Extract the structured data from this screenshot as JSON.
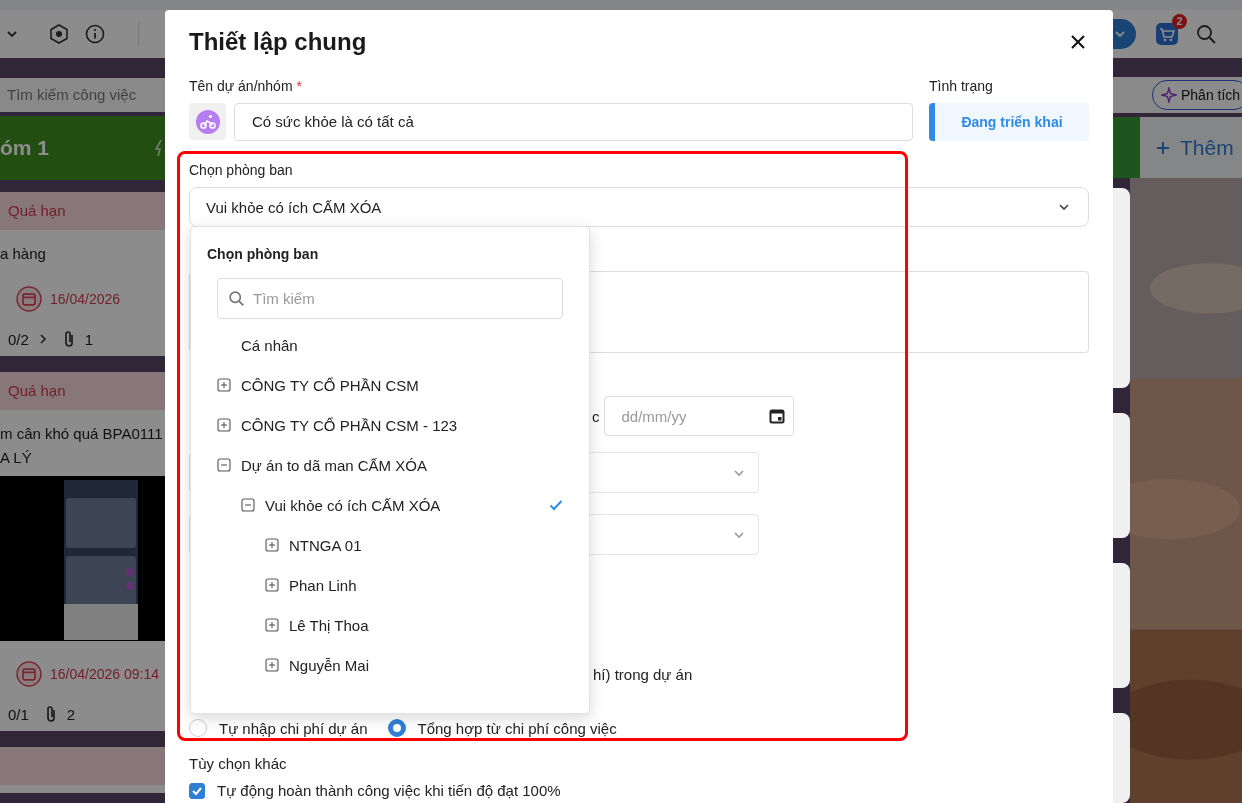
{
  "board": {
    "search": {
      "placeholder": "Tìm kiếm công việc"
    },
    "column_title": "óm 1",
    "cards": [
      {
        "overdue": true,
        "status": "Quá hạn",
        "lines": [
          "a hàng"
        ],
        "date": "16/04/2026",
        "subtasks": "0/2",
        "expandable": true,
        "attachments": "1"
      },
      {
        "overdue": true,
        "status": "Quá hạn",
        "lines": [
          "m cân khó quá BPA0111",
          "A LÝ"
        ],
        "picture": {
          "kind": "picture"
        },
        "date": "16/04/2026 09:14",
        "subtasks": "0/1",
        "expandable": false,
        "attachments": "2"
      },
      {
        "overdue": true
      }
    ],
    "cart_badge": "2",
    "analyze_button": "Phân tích",
    "add_column": "Thêm"
  },
  "dialog": {
    "title": "Thiết lập chung",
    "name_field": {
      "label": "Tên dự án/nhóm",
      "required_mark": "*",
      "value": "Có sức khỏe là có tất cả"
    },
    "status": {
      "label": "Tình trạng",
      "value": "Đang triển khai"
    },
    "department": {
      "label": "Chọn phòng ban",
      "value": "Vui khỏe có ích CẤM XÓA",
      "open": true
    },
    "dropdown": {
      "title": "Chọn phòng ban",
      "search_placeholder": "Tìm kiếm",
      "tree": [
        {
          "label": "Cá nhân",
          "selected": false
        },
        {
          "label": "CÔNG TY CỔ PHẦN CSM",
          "expanded": false,
          "selected": false
        },
        {
          "label": "CÔNG TY CỔ PHẦN CSM - 123",
          "expanded": false,
          "selected": false
        },
        {
          "label": "Dự án to dã man CẤM XÓA",
          "expanded": true,
          "selected": false,
          "children": [
            {
              "label": "Vui khỏe có ích CẤM XÓA",
              "expanded": true,
              "selected": true,
              "children": [
                {
                  "label": "NTNGA 01",
                  "expanded": false,
                  "selected": false
                },
                {
                  "label": "Phan Linh",
                  "expanded": false,
                  "selected": false
                },
                {
                  "label": "Lê Thị Thoa",
                  "expanded": false,
                  "selected": false
                },
                {
                  "label": "Nguyễn Mai",
                  "expanded": false,
                  "selected": false
                }
              ]
            }
          ]
        }
      ]
    },
    "date_label": "c",
    "date_placeholder": "dd/mm/yy",
    "cost_note": "hí) trong dự án",
    "cost_mode": [
      {
        "label": "Tự nhập chi phí dự án",
        "selected": false
      },
      {
        "label": "Tổng hợp từ chi phí công việc",
        "selected": true
      }
    ],
    "other_options": {
      "label": "Tùy chọn khác",
      "items": [
        {
          "label": "Tự động hoàn thành công việc khi tiến độ đạt 100%",
          "checked": true
        }
      ]
    }
  }
}
